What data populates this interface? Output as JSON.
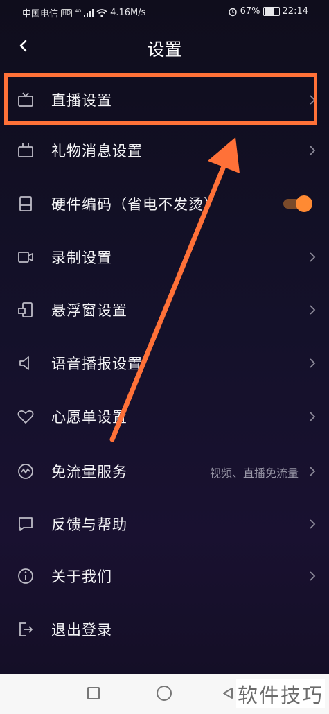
{
  "status_bar": {
    "carrier": "中国电信",
    "hd": "HD",
    "net": "⁴ᴳ",
    "speed": "4.16M/s",
    "battery": "67%",
    "battery_level": 0.67,
    "time": "22:14"
  },
  "header": {
    "title": "设置"
  },
  "items": [
    {
      "label": "直播设置",
      "icon": "tv-icon"
    },
    {
      "label": "礼物消息设置",
      "icon": "gift-tv-icon"
    },
    {
      "label": "硬件编码（省电不发烫）",
      "icon": "phone-chip-icon",
      "toggle_on": true
    },
    {
      "label": "录制设置",
      "icon": "video-camera-icon"
    },
    {
      "label": "悬浮窗设置",
      "icon": "floating-window-icon"
    },
    {
      "label": "语音播报设置",
      "icon": "speaker-icon"
    },
    {
      "label": "心愿单设置",
      "icon": "heart-icon"
    },
    {
      "label": "免流量服务",
      "icon": "data-free-icon",
      "extra": "视频、直播免流量"
    },
    {
      "label": "反馈与帮助",
      "icon": "feedback-icon"
    },
    {
      "label": "关于我们",
      "icon": "info-icon"
    },
    {
      "label": "退出登录",
      "icon": "logout-icon"
    }
  ],
  "annotation": {
    "color": "#ff7138",
    "highlighted_item": "直播设置"
  },
  "watermark": "软件技巧"
}
